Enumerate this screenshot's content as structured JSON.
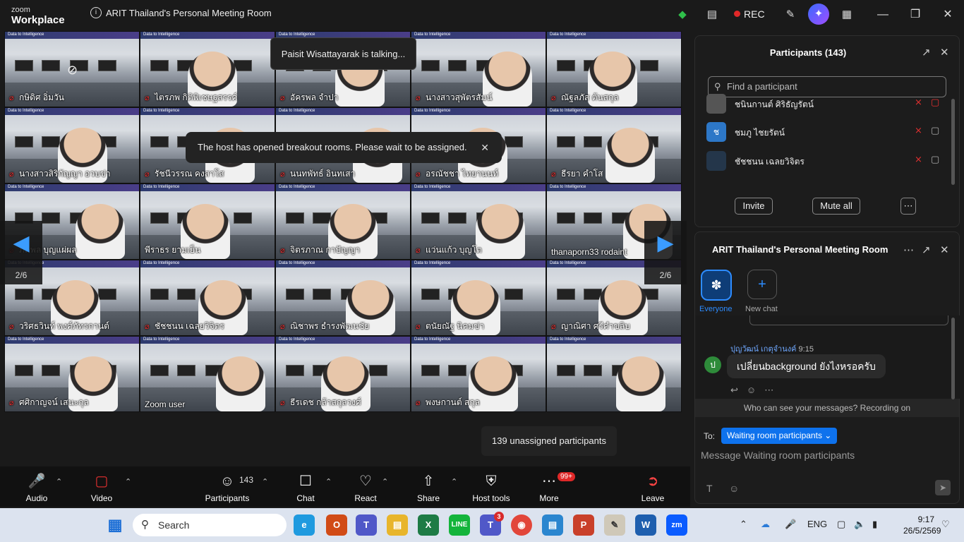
{
  "title_bar": {
    "brand_line1": "zoom",
    "brand_line2": "Workplace",
    "meeting_title": "ARIT Thailand's Personal Meeting Room",
    "rec_label": "REC"
  },
  "speaker_notice": "Paisit Wisattayarak is talking...",
  "breakout_notice": "The host has opened breakout rooms. Please wait to be assigned.",
  "unassigned_notice": "139 unassigned participants",
  "page_indicator": "2/6",
  "banner_text": "Data to Intelligence",
  "tiles": [
    {
      "name": "กษิดิศ อิ่มวัน",
      "muted": true,
      "camoff": true
    },
    {
      "name": "ไตรภพ กิติพิเชษฐสรรค์",
      "muted": true
    },
    {
      "name": "อัครพล จำปา",
      "muted": true
    },
    {
      "name": "นางสาวสุพัตรสัมน์",
      "muted": true
    },
    {
      "name": "ณัฐลภัส ต้นสกุล",
      "muted": true
    },
    {
      "name": "นางสาวสิริกัญญา อวบข่า",
      "muted": true
    },
    {
      "name": "รัชนีวรรณ คงสาโส",
      "muted": true
    },
    {
      "name": "นนทพัทธ์ อินทเสา",
      "muted": true
    },
    {
      "name": "อรณัชชา ไทยานนท์",
      "muted": true
    },
    {
      "name": "ธีรยา คำโส",
      "muted": true
    },
    {
      "name": "ภคพล บุญแผ่ผล",
      "muted": true
    },
    {
      "name": "พีราธร ยามเย็น",
      "muted": false
    },
    {
      "name": "จิตรภาณ กาปัญญา",
      "muted": true
    },
    {
      "name": "แว่นแก้ว บุญโต",
      "muted": true
    },
    {
      "name": "thanaporn33 rodaint",
      "muted": false
    },
    {
      "name": "วริศธวินท์ พงศ์ภัทรกานต์",
      "muted": true
    },
    {
      "name": "ชัชชนน เฉลยวิจิตร",
      "muted": true
    },
    {
      "name": "ณิชาพร ธำรงพัฒนชัย",
      "muted": true
    },
    {
      "name": "ตนัยณัฐ นิคมข่า",
      "muted": true
    },
    {
      "name": "ญาณิศา ศรีคำขลิบ",
      "muted": true
    },
    {
      "name": "ศศิกาญจน์ เสนะกุล",
      "muted": true
    },
    {
      "name": "Zoom user",
      "muted": false
    },
    {
      "name": "ธีรเดช กล้าสกุลวงศ์",
      "muted": true
    },
    {
      "name": "พงษกานต์ สกุล",
      "muted": true
    },
    {
      "name": "",
      "muted": false
    }
  ],
  "toolbar": {
    "audio": "Audio",
    "video": "Video",
    "participants": "Participants",
    "participants_count": "143",
    "chat": "Chat",
    "react": "React",
    "share": "Share",
    "host_tools": "Host tools",
    "more": "More",
    "more_badge": "99+",
    "leave": "Leave"
  },
  "participants_panel": {
    "title": "Participants (143)",
    "search_placeholder": "Find a participant",
    "rows": [
      {
        "name": "ชนินกานต์ ศิริธัญรัตน์",
        "avatar": ""
      },
      {
        "name": "ชมภู ไชยรัตน์",
        "avatar": "ช"
      },
      {
        "name": "ชัชชนน เฉลยวิจิตร",
        "avatar": ""
      }
    ],
    "invite": "Invite",
    "mute_all": "Mute all"
  },
  "chat_panel": {
    "title": "ARIT Thailand's Personal Meeting Room",
    "everyone": "Everyone",
    "new_chat": "New chat",
    "sender": "ปุญวัฒน์ เกตุจำนงค์",
    "time": "9:15",
    "avatar": "ป",
    "message": "เปลี่ยนbackground ยังไงหรอครับ",
    "who_can_see": "Who can see your messages? Recording on",
    "to_label": "To:",
    "to_value": "Waiting room participants",
    "input_placeholder": "Message Waiting room participants"
  },
  "taskbar": {
    "search": "Search",
    "language": "ENG",
    "time": "9:17",
    "date": "26/5/2569",
    "teams_badge": "3"
  }
}
